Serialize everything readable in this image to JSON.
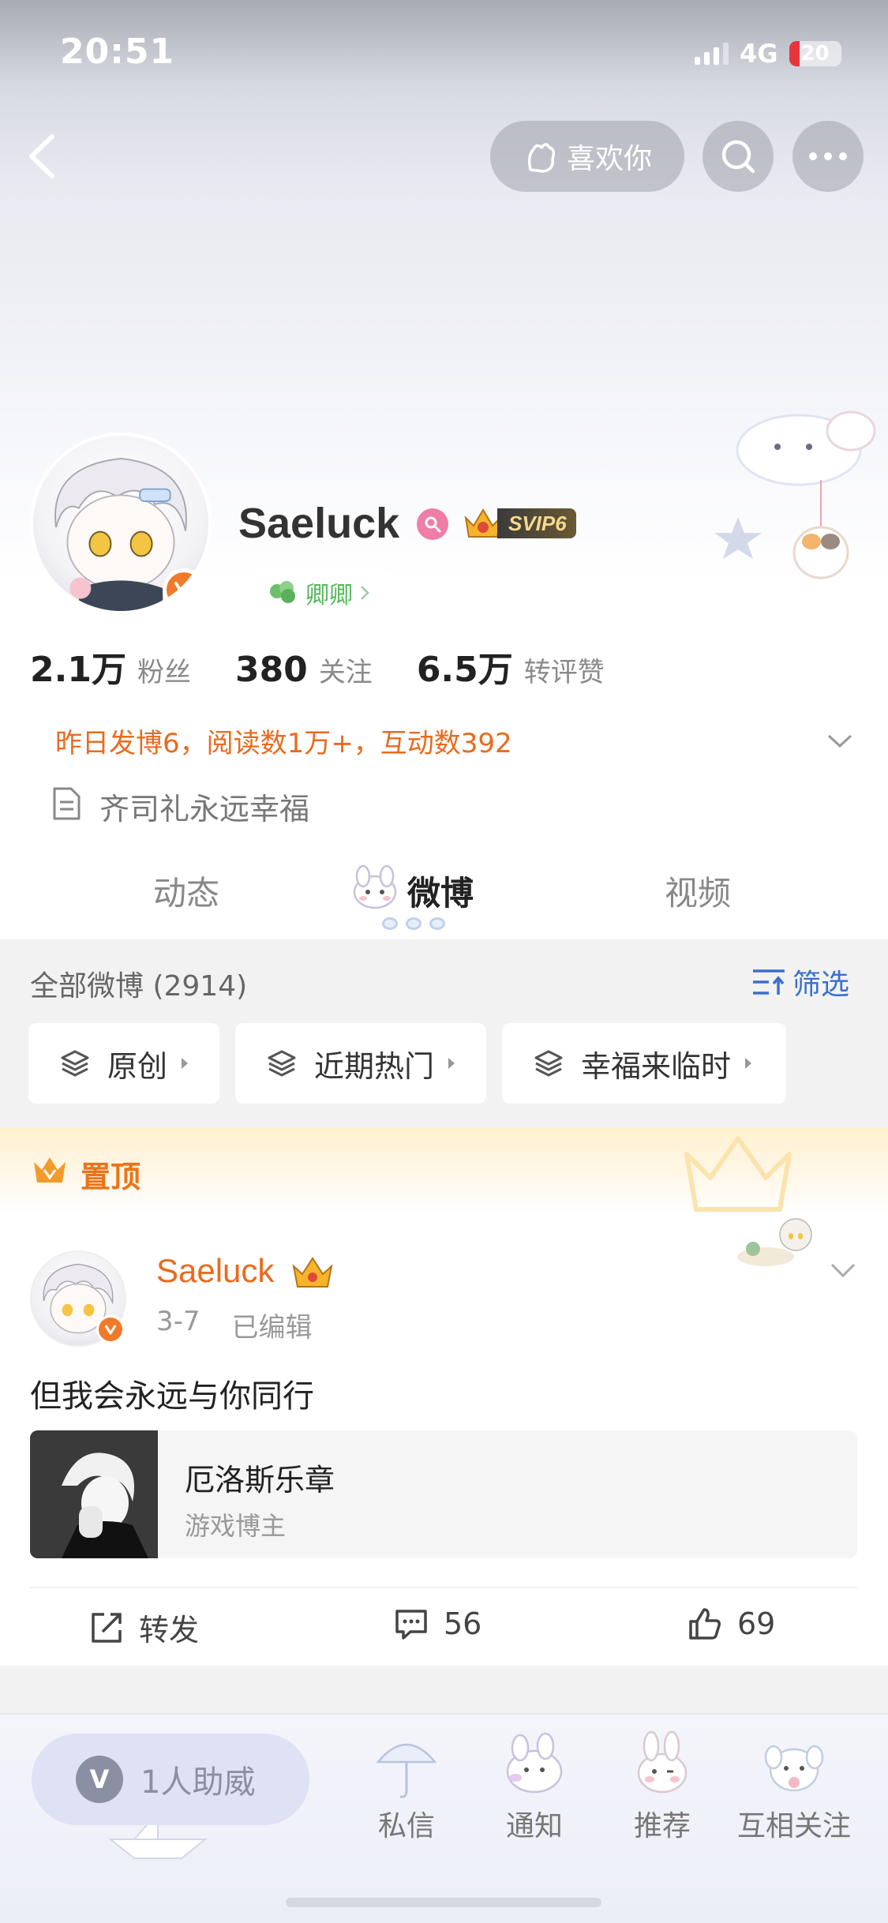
{
  "status_bar": {
    "time": "20:51",
    "network": "4G",
    "battery_level": "20",
    "battery_fraction": 0.2
  },
  "header": {
    "like_label": "喜欢你"
  },
  "profile": {
    "username": "Saeluck",
    "svip_label": "SVIP6",
    "group_label": "卿卿",
    "stats": [
      {
        "value": "2.1万",
        "label": "粉丝"
      },
      {
        "value": "380",
        "label": "关注"
      },
      {
        "value": "6.5万",
        "label": "转评赞"
      }
    ],
    "activity": "昨日发博6，阅读数1万+，互动数392",
    "bio": "齐司礼永远幸福"
  },
  "tabs": [
    {
      "label": "动态"
    },
    {
      "label": "微博"
    },
    {
      "label": "视频"
    }
  ],
  "feed_filter": {
    "all_count": "全部微博 (2914)",
    "filter_label": "筛选",
    "chips": [
      {
        "label": "原创"
      },
      {
        "label": "近期热门"
      },
      {
        "label": "幸福来临时"
      }
    ]
  },
  "pinned_post": {
    "pinned_label": "置顶",
    "author": "Saeluck",
    "date": "3-7",
    "edited": "已编辑",
    "text": "但我会永远与你同行",
    "link_card": {
      "title": "厄洛斯乐章",
      "subtitle": "游戏博主"
    },
    "actions": {
      "repost": "转发",
      "comments": "56",
      "likes": "69"
    }
  },
  "bottom_bar": {
    "assist_label": "1人助威",
    "assist_icon_letter": "V",
    "nav": [
      {
        "label": "私信"
      },
      {
        "label": "通知"
      },
      {
        "label": "推荐"
      },
      {
        "label": "互相关注"
      }
    ]
  },
  "colors": {
    "accent_orange": "#ea6a1e",
    "link_blue": "#3a6fd0",
    "group_green": "#55b85a"
  }
}
